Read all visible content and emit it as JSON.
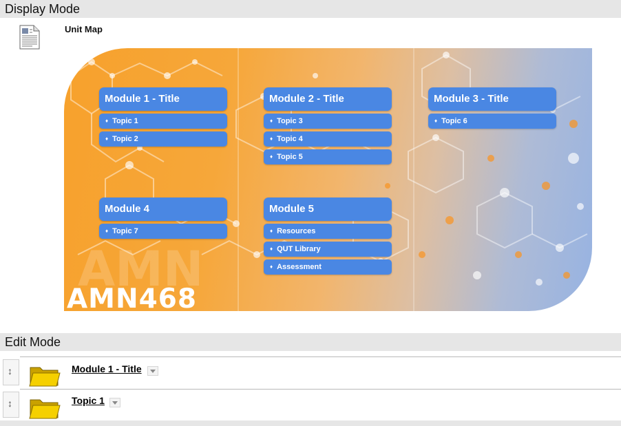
{
  "display_mode": {
    "header": "Display Mode",
    "item_title": "Unit Map",
    "item_icon": "document-icon",
    "banner": {
      "course_code": "AMN468",
      "colors": {
        "orange": "#f7a12c",
        "blue": "#97b3e2",
        "button": "#4a87e3"
      },
      "modules": [
        {
          "title": "Module 1 - Title",
          "topics": [
            "Topic 1",
            "Topic 2"
          ]
        },
        {
          "title": "Module 2 - Title",
          "topics": [
            "Topic 3",
            "Topic 4",
            "Topic 5"
          ]
        },
        {
          "title": "Module 3 - Title",
          "topics": [
            "Topic 6"
          ]
        },
        {
          "title": "Module 4",
          "topics": [
            "Topic 7"
          ]
        },
        {
          "title": "Module 5",
          "topics": [
            "Resources",
            "QUT Library",
            "Assessment"
          ]
        }
      ]
    }
  },
  "edit_mode": {
    "header": "Edit Mode",
    "handle_icon": "drag-handle-icon",
    "item_icon": "folder-icon",
    "rows": [
      {
        "title": "Module 1 - Title"
      },
      {
        "title": "Topic 1"
      }
    ]
  }
}
